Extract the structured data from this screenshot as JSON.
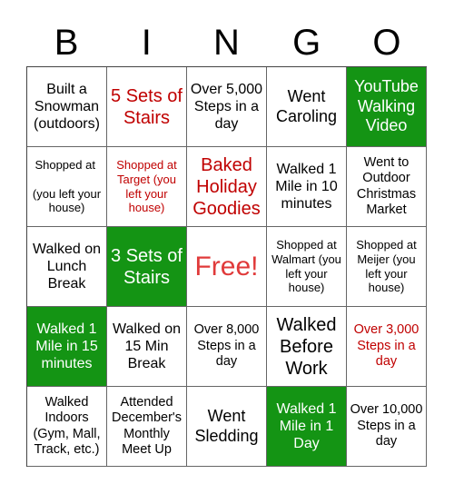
{
  "header": [
    "B",
    "I",
    "N",
    "G",
    "O"
  ],
  "colors": {
    "marked": "#149414",
    "red_text": "#c00000",
    "free_text": "#e03a3a"
  },
  "cells": [
    {
      "text": "Built a Snowman (outdoors)",
      "state": "normal",
      "size": "md"
    },
    {
      "text": "5 Sets of Stairs",
      "state": "red",
      "size": "xl"
    },
    {
      "text": "Over 5,000 Steps in a day",
      "state": "normal",
      "size": "md"
    },
    {
      "text": "Went Caroling",
      "state": "normal",
      "size": "lg"
    },
    {
      "text": "YouTube Walking Video",
      "state": "marked",
      "size": "lg"
    },
    {
      "text": "Shopped at \n\n(you left your house)",
      "state": "normal",
      "size": "xs"
    },
    {
      "text": "Shopped at Target (you left your house)",
      "state": "red",
      "size": "xs"
    },
    {
      "text": "Baked Holiday Goodies",
      "state": "red",
      "size": "xl"
    },
    {
      "text": "Walked 1 Mile in 10 minutes",
      "state": "normal",
      "size": "md"
    },
    {
      "text": "Went to Outdoor Christmas Market",
      "state": "normal",
      "size": "sm"
    },
    {
      "text": "Walked on Lunch Break",
      "state": "normal",
      "size": "md"
    },
    {
      "text": "3 Sets of Stairs",
      "state": "marked",
      "size": "xl"
    },
    {
      "text": "Free!",
      "state": "free",
      "size": "xxl"
    },
    {
      "text": "Shopped at Walmart (you left your house)",
      "state": "normal",
      "size": "xs"
    },
    {
      "text": "Shopped at Meijer (you left your house)",
      "state": "normal",
      "size": "xs"
    },
    {
      "text": "Walked 1 Mile in 15 minutes",
      "state": "marked",
      "size": "md"
    },
    {
      "text": "Walked on 15 Min Break",
      "state": "normal",
      "size": "md"
    },
    {
      "text": "Over 8,000 Steps in a day",
      "state": "normal",
      "size": "sm"
    },
    {
      "text": "Walked Before Work",
      "state": "normal",
      "size": "xl"
    },
    {
      "text": "Over 3,000 Steps in a day",
      "state": "red",
      "size": "sm"
    },
    {
      "text": "Walked Indoors (Gym, Mall, Track, etc.)",
      "state": "normal",
      "size": "sm"
    },
    {
      "text": "Attended December's Monthly Meet Up",
      "state": "normal",
      "size": "sm"
    },
    {
      "text": "Went Sledding",
      "state": "normal",
      "size": "lg"
    },
    {
      "text": "Walked 1 Mile in 1 Day",
      "state": "marked",
      "size": "md"
    },
    {
      "text": "Over 10,000 Steps in a day",
      "state": "normal",
      "size": "sm"
    }
  ]
}
